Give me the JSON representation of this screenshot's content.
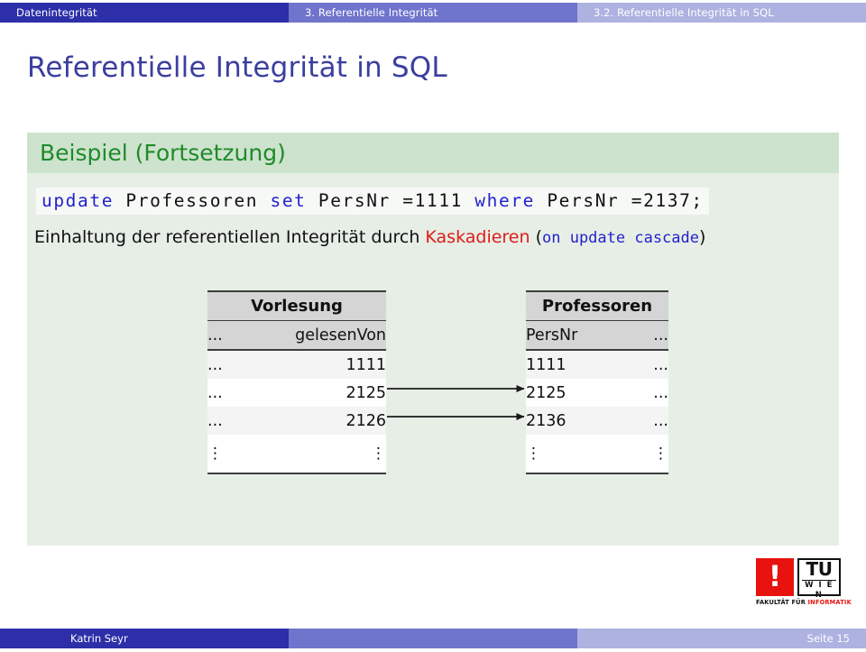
{
  "navbar": {
    "segments": [
      {
        "label": "Datenintegrität",
        "color": "#2c2fa8"
      },
      {
        "label": "3. Referentielle Integrität",
        "color": "#6f74cc"
      },
      {
        "label": "3.2. Referentielle Integrität in SQL",
        "color": "#aeb2e0"
      }
    ]
  },
  "title": "Referentielle Integrität in SQL",
  "block": {
    "heading": "Beispiel (Fortsetzung)",
    "code": {
      "kw_update": "update",
      "tbl": "Professoren",
      "kw_set": "set",
      "assign": "PersNr =1111",
      "kw_where": "where",
      "cond": "PersNr =2137;"
    },
    "explanation": {
      "pre": "Einhaltung der referentiellen Integrität durch ",
      "highlight": "Kaskadieren",
      "paren_open": " (",
      "clause": "on update cascade",
      "paren_close": ")"
    }
  },
  "tables": {
    "vorlesung": {
      "name": "Vorlesung",
      "columns": [
        "...",
        "gelesenVon"
      ],
      "rows": [
        [
          "...",
          "1111"
        ],
        [
          "...",
          "2125"
        ],
        [
          "...",
          "2126"
        ],
        [
          "⋮",
          "⋮"
        ]
      ]
    },
    "professoren": {
      "name": "Professoren",
      "columns": [
        "PersNr",
        "..."
      ],
      "rows": [
        [
          "1111",
          "..."
        ],
        [
          "2125",
          "..."
        ],
        [
          "2136",
          "..."
        ],
        [
          "⋮",
          "⋮"
        ]
      ]
    }
  },
  "logo": {
    "mark": "!",
    "tu": "TU",
    "wien": "W I E N",
    "caption_1": "FAKULTÄT FÜR ",
    "caption_2": "INFORMATIK"
  },
  "footer": {
    "author": "Katrin Seyr",
    "page": "Seite 15"
  },
  "colors": {
    "nav_dark": "#2c2fa8",
    "nav_mid": "#6f74cc",
    "nav_light": "#aeb2e0",
    "title_blue": "#3b3f9e",
    "block_head_green": "#cde3cd",
    "block_body_green": "#e6eee6",
    "heading_green": "#1f8a2a",
    "keyword_blue": "#2222cc",
    "highlight_red": "#e01b16",
    "logo_red": "#e8130f"
  }
}
